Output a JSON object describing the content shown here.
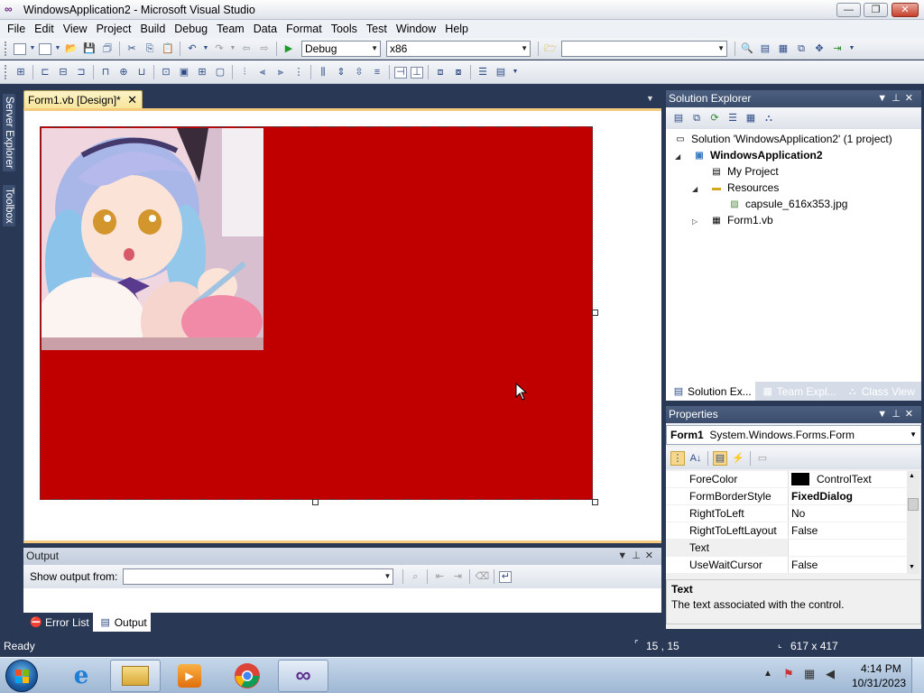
{
  "window": {
    "title": "WindowsApplication2 - Microsoft Visual Studio",
    "app_icon": "visual-studio-icon"
  },
  "menubar": [
    "File",
    "Edit",
    "View",
    "Project",
    "Build",
    "Debug",
    "Team",
    "Data",
    "Format",
    "Tools",
    "Test",
    "Window",
    "Help"
  ],
  "toolbar": {
    "config": "Debug",
    "platform": "x86",
    "search_value": ""
  },
  "side_tabs": [
    "Server Explorer",
    "Toolbox"
  ],
  "document_tab": {
    "label": "Form1.vb [Design]*"
  },
  "solution_explorer": {
    "title": "Solution Explorer",
    "items": [
      {
        "label": "Solution 'WindowsApplication2' (1 project)",
        "icon": "solution-icon"
      },
      {
        "label": "WindowsApplication2",
        "icon": "vb-project-icon",
        "bold": true
      },
      {
        "label": "My Project",
        "icon": "my-project-icon"
      },
      {
        "label": "Resources",
        "icon": "folder-icon"
      },
      {
        "label": "capsule_616x353.jpg",
        "icon": "image-file-icon"
      },
      {
        "label": "Form1.vb",
        "icon": "form-file-icon"
      }
    ],
    "tabs": [
      "Solution Ex...",
      "Team Expl...",
      "Class View"
    ]
  },
  "properties": {
    "title": "Properties",
    "object": "Form1",
    "object_type": "System.Windows.Forms.Form",
    "rows": [
      {
        "name": "ForeColor",
        "value": "ControlText",
        "swatch": "#000000"
      },
      {
        "name": "FormBorderStyle",
        "value": "FixedDialog",
        "bold": true
      },
      {
        "name": "RightToLeft",
        "value": "No"
      },
      {
        "name": "RightToLeftLayout",
        "value": "False"
      },
      {
        "name": "Text",
        "value": ""
      },
      {
        "name": "UseWaitCursor",
        "value": "False"
      }
    ],
    "desc_title": "Text",
    "desc_text": "The text associated with the control."
  },
  "output": {
    "title": "Output",
    "show_from_label": "Show output from:",
    "show_from_value": "",
    "tabs": [
      "Error List",
      "Output"
    ]
  },
  "status": {
    "text": "Ready",
    "position": "15 , 15",
    "size": "617 x 417"
  },
  "taskbar": {
    "time": "4:14 PM",
    "date": "10/31/2023",
    "apps": [
      "internet-explorer-icon",
      "file-explorer-icon",
      "media-player-icon",
      "chrome-icon",
      "visual-studio-icon"
    ]
  },
  "colors": {
    "form_backcolor": "#C00000",
    "chrome_dark": "#293955"
  }
}
